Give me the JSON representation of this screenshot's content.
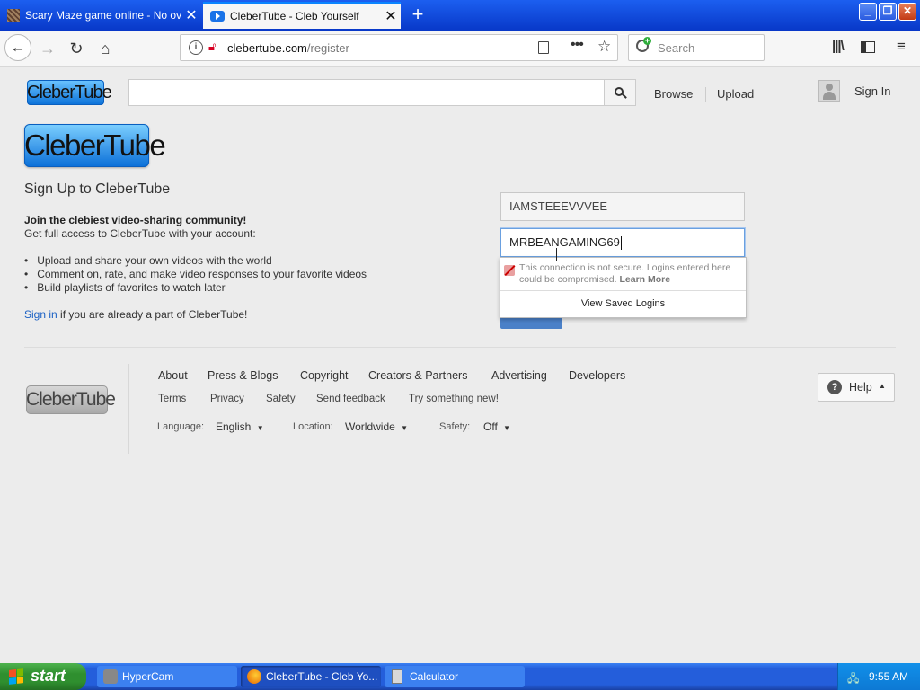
{
  "browser": {
    "tabs": [
      {
        "title": "Scary Maze game online - No over"
      },
      {
        "title": "CleberTube - Cleb Yourself"
      }
    ],
    "url": {
      "domain": "clebertube.com",
      "path": "/register"
    },
    "search_placeholder": "Search"
  },
  "site": {
    "logo_text": "CleberTube",
    "nav": {
      "browse": "Browse",
      "upload": "Upload",
      "sign_in": "Sign In"
    }
  },
  "signup": {
    "heading": "Sign Up to CleberTube",
    "join_bold": "Join the clebiest video-sharing community!",
    "subtext": "Get full access to CleberTube with your account:",
    "bullets": [
      "Upload and share your own videos with the world",
      "Comment on, rate, and make video responses to your favorite videos",
      "Build playlists of favorites to watch later"
    ],
    "signin_link": "Sign in",
    "signin_rest": " if you are already a part of CleberTube!",
    "username_value": "IAMSTEEEVVVEE",
    "password_value": "MRBEANGAMING69",
    "warning_text": "This connection is not secure. Logins entered here could be compromised.",
    "learn_more": "Learn More",
    "view_saved_logins": "View Saved Logins"
  },
  "footer": {
    "row1": [
      "About",
      "Press & Blogs",
      "Copyright",
      "Creators & Partners",
      "Advertising",
      "Developers"
    ],
    "row2": [
      "Terms",
      "Privacy",
      "Safety",
      "Send feedback",
      "Try something new!"
    ],
    "language_label": "Language:",
    "language_value": "English",
    "location_label": "Location:",
    "location_value": "Worldwide",
    "safety_label": "Safety:",
    "safety_value": "Off",
    "help_label": "Help"
  },
  "taskbar": {
    "start_label": "start",
    "tasks": [
      "HyperCam",
      "CleberTube - Cleb Yo...",
      "Calculator"
    ],
    "clock": "9:55 AM"
  }
}
